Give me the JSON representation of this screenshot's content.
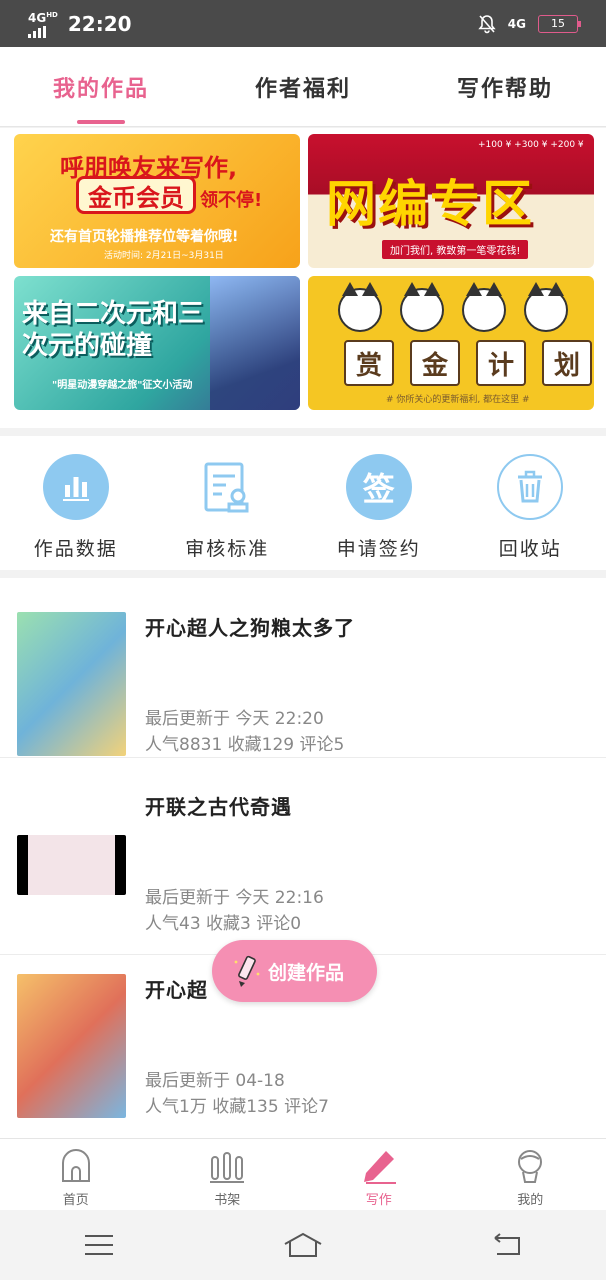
{
  "status_bar": {
    "network": "4G",
    "network_sup": "HD",
    "time": "22:20",
    "network_right": "4G",
    "battery": "15"
  },
  "tabs": [
    {
      "label": "我的作品",
      "active": true
    },
    {
      "label": "作者福利",
      "active": false
    },
    {
      "label": "写作帮助",
      "active": false
    }
  ],
  "banners": {
    "b1": {
      "line1": "呼朋唤友来写作,",
      "coin": "金币会员",
      "line2": "领不停!",
      "line3": "还有首页轮播推荐位等着你哦!",
      "date": "活动时间: 2月21日~3月31日"
    },
    "b2": {
      "title": "网编专区",
      "sub": "加门我们, 教致第一笔零花钱!",
      "coins": "+100 ¥  +300 ¥  +200 ¥"
    },
    "b3": {
      "title": "来自二次元和三次元的碰撞",
      "sub": "\"明星动漫穿越之旅\"征文小活动"
    },
    "b4": {
      "chars": [
        "赏",
        "金",
        "计",
        "划"
      ],
      "sub": "# 你所关心的更新福利, 都在这里 #"
    }
  },
  "quick_entries": [
    {
      "label": "作品数据",
      "icon": "bar-chart-icon"
    },
    {
      "label": "审核标准",
      "icon": "review-document-icon"
    },
    {
      "label": "申请签约",
      "icon": "sign-icon",
      "icon_text": "签"
    },
    {
      "label": "回收站",
      "icon": "trash-icon"
    }
  ],
  "works": [
    {
      "title": "开心超人之狗粮太多了",
      "updated": "最后更新于 今天 22:20",
      "stats": "人气8831 收藏129 评论5"
    },
    {
      "title": "开联之古代奇遇",
      "updated": "最后更新于 今天 22:16",
      "stats": "人气43 收藏3 评论0"
    },
    {
      "title": "开心超",
      "updated": "最后更新于 04-18",
      "stats": "人气1万 收藏135 评论7"
    }
  ],
  "fab": {
    "label": "创建作品"
  },
  "bottom_nav": [
    {
      "label": "首页",
      "icon": "home-icon"
    },
    {
      "label": "书架",
      "icon": "bookshelf-icon"
    },
    {
      "label": "写作",
      "icon": "pen-icon",
      "active": true
    },
    {
      "label": "我的",
      "icon": "profile-icon"
    }
  ],
  "colors": {
    "accent": "#e8638f",
    "icon_blue": "#8ec9f0",
    "fab": "#f58fb3"
  }
}
